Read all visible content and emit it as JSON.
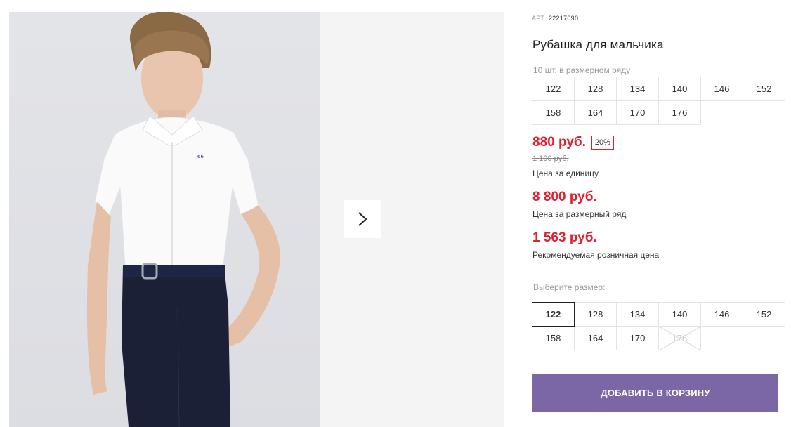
{
  "gallery": {
    "next_icon": "chevron-right-icon"
  },
  "product": {
    "sku_label": "АРТ",
    "sku_value": "22217090",
    "title": "Рубашка для мальчика",
    "pack_note": "10 шт. в размерном ряду",
    "pack_sizes": [
      "122",
      "128",
      "134",
      "140",
      "146",
      "152",
      "158",
      "164",
      "170",
      "176"
    ],
    "price": "880 руб.",
    "discount": "20%",
    "old_price": "1 100 руб.",
    "price_caption": "Цена за единицу",
    "pack_price": "8 800 руб.",
    "pack_price_caption": "Цена за размерный ряд",
    "retail_price": "1 563 руб.",
    "retail_price_caption": "Рекомендуемая розничная цена",
    "choose_size_label": "Выберите размер:",
    "sizes": [
      {
        "label": "122",
        "state": "selected"
      },
      {
        "label": "128",
        "state": "available"
      },
      {
        "label": "134",
        "state": "available"
      },
      {
        "label": "140",
        "state": "available"
      },
      {
        "label": "146",
        "state": "available"
      },
      {
        "label": "152",
        "state": "available"
      },
      {
        "label": "158",
        "state": "available"
      },
      {
        "label": "164",
        "state": "available"
      },
      {
        "label": "170",
        "state": "available"
      },
      {
        "label": "176",
        "state": "unavailable"
      }
    ],
    "add_to_cart_label": "ДОБАВИТЬ В КОРЗИНУ"
  },
  "colors": {
    "price_red": "#e0202e",
    "button_purple": "#7b66a6"
  }
}
